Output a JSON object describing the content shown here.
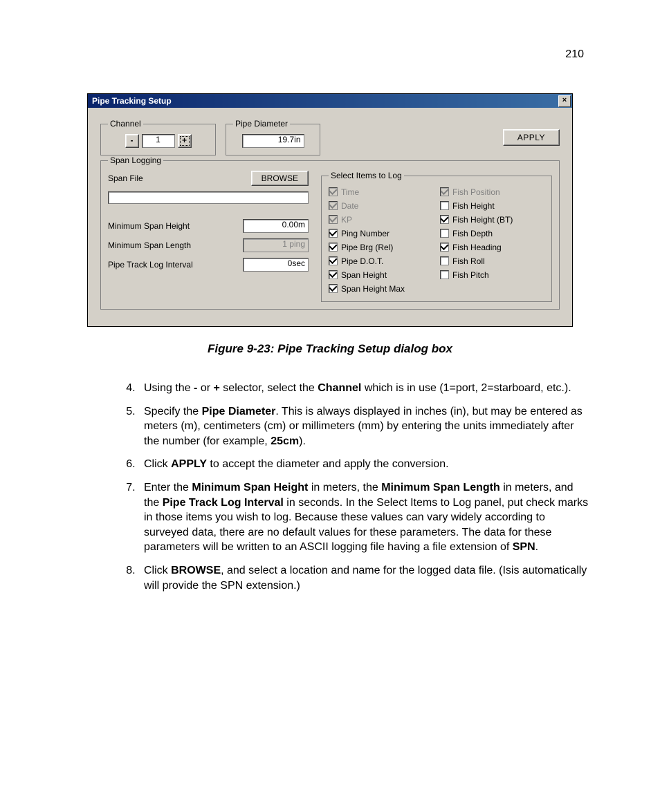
{
  "page_number": "210",
  "dialog": {
    "title": "Pipe Tracking Setup",
    "close_glyph": "×",
    "channel": {
      "legend": "Channel",
      "minus": "-",
      "plus": "+",
      "value": "1"
    },
    "pipe_diameter": {
      "legend": "Pipe Diameter",
      "value": "19.7in"
    },
    "apply_label": "APPLY",
    "span_logging": {
      "legend": "Span Logging",
      "span_file_label": "Span File",
      "browse_label": "BROWSE",
      "span_file_value": "",
      "min_span_height_label": "Minimum Span Height",
      "min_span_height_value": "0.00m",
      "min_span_length_label": "Minimum Span Length",
      "min_span_length_value": "1 ping",
      "log_interval_label": "Pipe Track Log Interval",
      "log_interval_value": "0sec"
    },
    "select_items": {
      "legend": "Select Items to Log",
      "col1": [
        {
          "label": "Time",
          "checked": true,
          "disabled": true
        },
        {
          "label": "Date",
          "checked": true,
          "disabled": true
        },
        {
          "label": "KP",
          "checked": true,
          "disabled": true
        },
        {
          "label": "Ping Number",
          "checked": true,
          "disabled": false
        },
        {
          "label": "Pipe Brg (Rel)",
          "checked": true,
          "disabled": false
        },
        {
          "label": "Pipe D.O.T.",
          "checked": true,
          "disabled": false
        },
        {
          "label": "Span Height",
          "checked": true,
          "disabled": false
        },
        {
          "label": "Span Height Max",
          "checked": true,
          "disabled": false
        }
      ],
      "col2": [
        {
          "label": "Fish Position",
          "checked": true,
          "disabled": true
        },
        {
          "label": "Fish Height",
          "checked": false,
          "disabled": false
        },
        {
          "label": "Fish Height (BT)",
          "checked": true,
          "disabled": false
        },
        {
          "label": "Fish Depth",
          "checked": false,
          "disabled": false
        },
        {
          "label": "Fish Heading",
          "checked": true,
          "disabled": false
        },
        {
          "label": "Fish Roll",
          "checked": false,
          "disabled": false
        },
        {
          "label": "Fish Pitch",
          "checked": false,
          "disabled": false
        }
      ]
    }
  },
  "figure_caption": "Figure 9-23: Pipe Tracking Setup dialog box",
  "steps": {
    "s4": {
      "prefix": "Using the ",
      "b1": "-",
      "mid1": " or ",
      "b2": "+",
      "mid2": " selector, select the ",
      "b3": "Channel",
      "suffix": " which is in use (1=port, 2=starboard, etc.)."
    },
    "s5": {
      "prefix": "Specify the ",
      "b1": "Pipe Diameter",
      "mid": ". This is always displayed in inches (in), but may be entered as meters (m), centimeters (cm) or millimeters (mm) by entering the units immediately after the number (for example, ",
      "b2": "25cm",
      "suffix": ")."
    },
    "s6": {
      "prefix": "Click ",
      "b1": "APPLY",
      "suffix": " to accept the diameter and apply the conversion."
    },
    "s7": {
      "prefix": "Enter the ",
      "b1": "Minimum Span Height",
      "mid1": " in meters, the ",
      "b2": "Minimum Span Length",
      "mid2": " in meters, and the ",
      "b3": "Pipe Track Log Interval",
      "mid3": " in seconds. In the Select Items to Log panel, put check marks in those items you wish to log. Because these values can vary widely according to surveyed data, there are no default values for these parameters. The data for these parameters will be written to an ASCII logging file having a file extension of ",
      "b4": "SPN",
      "suffix": "."
    },
    "s8": {
      "prefix": "Click ",
      "b1": "BROWSE",
      "suffix": ", and select a location and name for the logged data file. (Isis automatically will provide the SPN extension.)"
    }
  }
}
